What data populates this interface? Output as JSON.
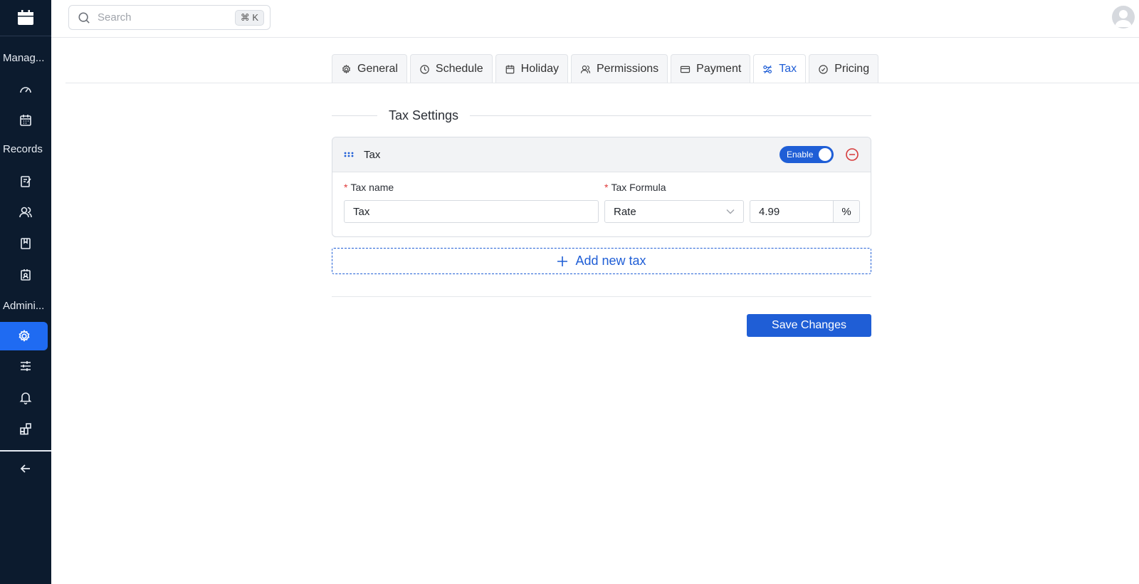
{
  "sidebar": {
    "sections": [
      {
        "label": "Manag..."
      },
      {
        "label": "Records"
      },
      {
        "label": "Admini..."
      }
    ],
    "icons": [
      "calendar-app-icon",
      "gauge-icon",
      "calendar-icon",
      "edit-note-icon",
      "users-icon",
      "bookmark-icon",
      "contact-card-icon",
      "gear-icon",
      "sliders-icon",
      "bell-icon",
      "widgets-icon",
      "arrow-left-icon"
    ]
  },
  "search": {
    "placeholder": "Search",
    "shortcut": "⌘ K"
  },
  "tabs": [
    {
      "label": "General",
      "icon": "gear-icon"
    },
    {
      "label": "Schedule",
      "icon": "clock-icon"
    },
    {
      "label": "Holiday",
      "icon": "calendar-icon"
    },
    {
      "label": "Permissions",
      "icon": "users-icon"
    },
    {
      "label": "Payment",
      "icon": "card-icon"
    },
    {
      "label": "Tax",
      "icon": "tax-icon"
    },
    {
      "label": "Pricing",
      "icon": "check-circle-icon"
    }
  ],
  "active_tab": "Tax",
  "section_title": "Tax Settings",
  "tax_card": {
    "title": "Tax",
    "toggle_label": "Enable",
    "tax_name_label": "Tax name",
    "tax_name_value": "Tax",
    "formula_label": "Tax Formula",
    "formula_value": "Rate",
    "rate_value": "4.99",
    "rate_unit": "%"
  },
  "add_label": "Add new tax",
  "save_label": "Save Changes",
  "colors": {
    "sidebar": "#0c1b2e",
    "accent": "#1f5ed6",
    "danger": "#d63a3a"
  }
}
